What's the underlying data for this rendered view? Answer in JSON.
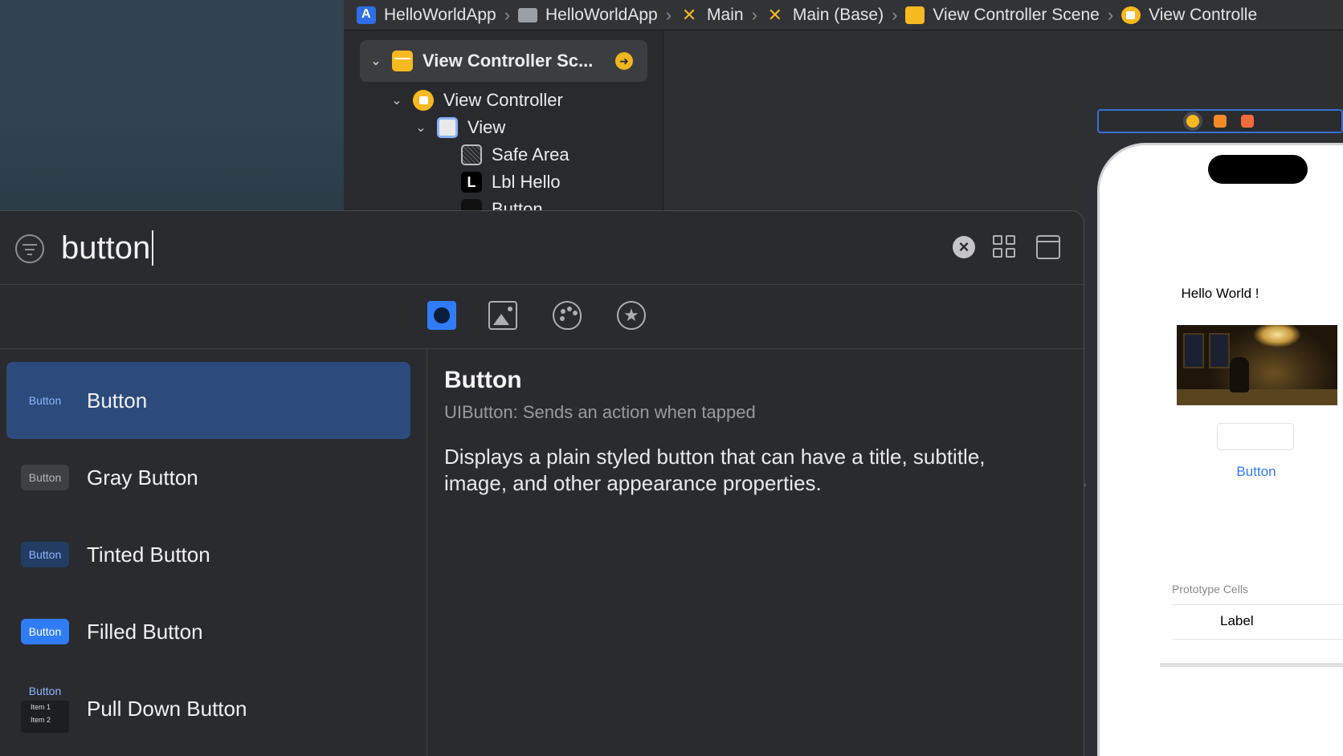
{
  "breadcrumb": [
    {
      "label": "HelloWorldApp",
      "icon": "app-project-icon"
    },
    {
      "label": "HelloWorldApp",
      "icon": "folder-icon"
    },
    {
      "label": "Main",
      "icon": "storyboard-icon"
    },
    {
      "label": "Main (Base)",
      "icon": "storyboard-icon"
    },
    {
      "label": "View Controller Scene",
      "icon": "scene-icon"
    },
    {
      "label": "View Controlle",
      "icon": "view-controller-icon"
    }
  ],
  "outline": {
    "scene": "View Controller Sc...",
    "view_controller": "View Controller",
    "view": "View",
    "safe_area": "Safe Area",
    "label_item": "Lbl Hello",
    "label_item_badge": "L",
    "button_item": "Button"
  },
  "canvas": {
    "hello_label": "Hello World !",
    "button_label": "Button",
    "prototype_cells_title": "Prototype Cells",
    "cell_label": "Label"
  },
  "library": {
    "search": {
      "value": "button",
      "placeholder": ""
    },
    "tabs": [
      "objects",
      "media",
      "colors",
      "snippets"
    ],
    "results": [
      {
        "thumb": "Button",
        "name": "Button",
        "selected": true
      },
      {
        "thumb": "Button",
        "name": "Gray Button"
      },
      {
        "thumb": "Button",
        "name": "Tinted Button"
      },
      {
        "thumb": "Button",
        "name": "Filled Button"
      },
      {
        "thumb": "Button",
        "name": "Pull Down Button",
        "menu_items": [
          "Item 1",
          "Item 2"
        ]
      }
    ],
    "detail": {
      "title": "Button",
      "subtitle": "UIButton: Sends an action when tapped",
      "description": "Displays a plain styled button that can have a title, subtitle, image, and other appearance properties."
    }
  },
  "colors": {
    "accent": "#2f7cf6",
    "selection": "#2c4a7c",
    "scene_icon": "#f6b91f"
  }
}
